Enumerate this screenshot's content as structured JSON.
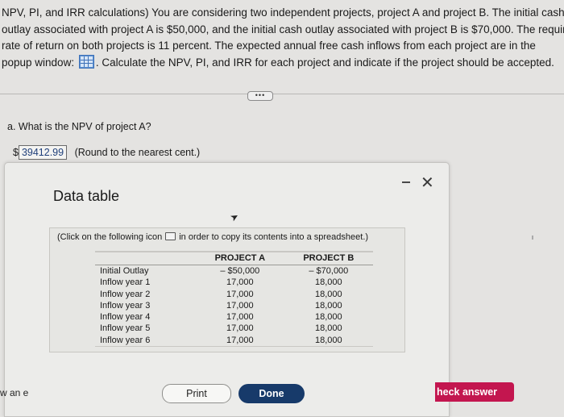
{
  "problem": {
    "lines": [
      "NPV, PI, and IRR calculations) You are considering two independent projects, project A and project B. The initial cash",
      "outlay associated with project A is $50,000, and the initial cash outlay associated with project B is $70,000. The required",
      "rate of return on both projects is 11 percent. The expected annual free cash inflows from each project are in the"
    ],
    "line4_before": "popup window:",
    "line4_after": ". Calculate the NPV, PI, and IRR for each project and indicate if the project should be accepted."
  },
  "more_label": "•••",
  "question": {
    "text": "a. What is the NPV of project A?",
    "currency": "$",
    "answer_value": "39412.99",
    "hint": "(Round to the nearest cent.)"
  },
  "modal": {
    "title": "Data table",
    "note_before": "(Click on the following icon",
    "note_after": "in order to copy its contents into a spreadsheet.)",
    "columns": [
      "PROJECT A",
      "PROJECT B"
    ],
    "rows": [
      {
        "label": "Initial Outlay",
        "a": "– $50,000",
        "b": "– $70,000"
      },
      {
        "label": "Inflow year 1",
        "a": "17,000",
        "b": "18,000"
      },
      {
        "label": "Inflow year 2",
        "a": "17,000",
        "b": "18,000"
      },
      {
        "label": "Inflow year 3",
        "a": "17,000",
        "b": "18,000"
      },
      {
        "label": "Inflow year 4",
        "a": "17,000",
        "b": "18,000"
      },
      {
        "label": "Inflow year 5",
        "a": "17,000",
        "b": "18,000"
      },
      {
        "label": "Inflow year 6",
        "a": "17,000",
        "b": "18,000"
      }
    ],
    "print_label": "Print",
    "done_label": "Done",
    "close_glyph": "✕"
  },
  "left_fragment": "w an e",
  "check_answer_label": "heck answer",
  "colors": {
    "check_answer": "#c3164f",
    "done_button": "#173a6a"
  }
}
